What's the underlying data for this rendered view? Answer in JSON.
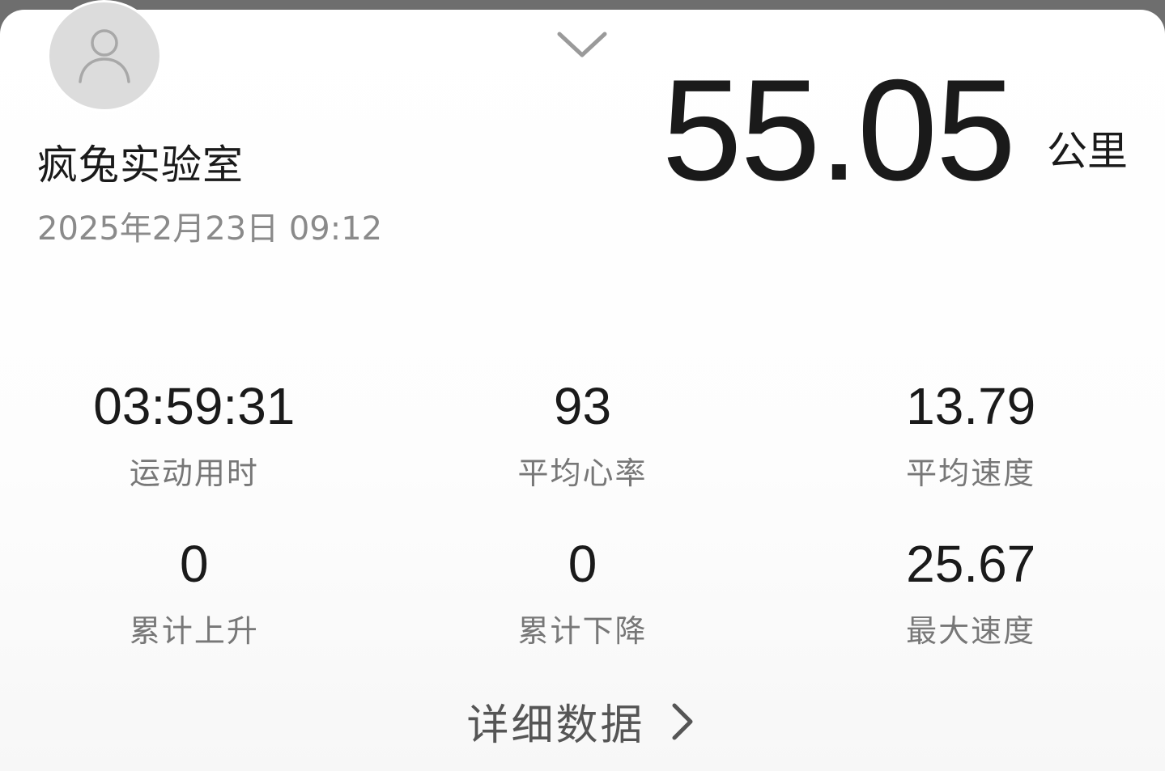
{
  "profile": {
    "name": "疯兔实验室",
    "datetime": "2025年2月23日 09:12",
    "avatar_icon": "person-icon"
  },
  "distance": {
    "value": "55.05",
    "unit": "公里"
  },
  "stats": {
    "row1": [
      {
        "value": "03:59:31",
        "label": "运动用时"
      },
      {
        "value": "93",
        "label": "平均心率"
      },
      {
        "value": "13.79",
        "label": "平均速度"
      }
    ],
    "row2": [
      {
        "value": "0",
        "label": "累计上升"
      },
      {
        "value": "0",
        "label": "累计下降"
      },
      {
        "value": "25.67",
        "label": "最大速度"
      }
    ]
  },
  "detail": {
    "label": "详细数据",
    "icon": "chevron-right-icon"
  },
  "header": {
    "handle_icon": "chevron-down-icon"
  },
  "colors": {
    "text_primary": "#1a1a1a",
    "text_secondary": "#8a8a8a",
    "avatar_bg": "#dcdcdc"
  }
}
